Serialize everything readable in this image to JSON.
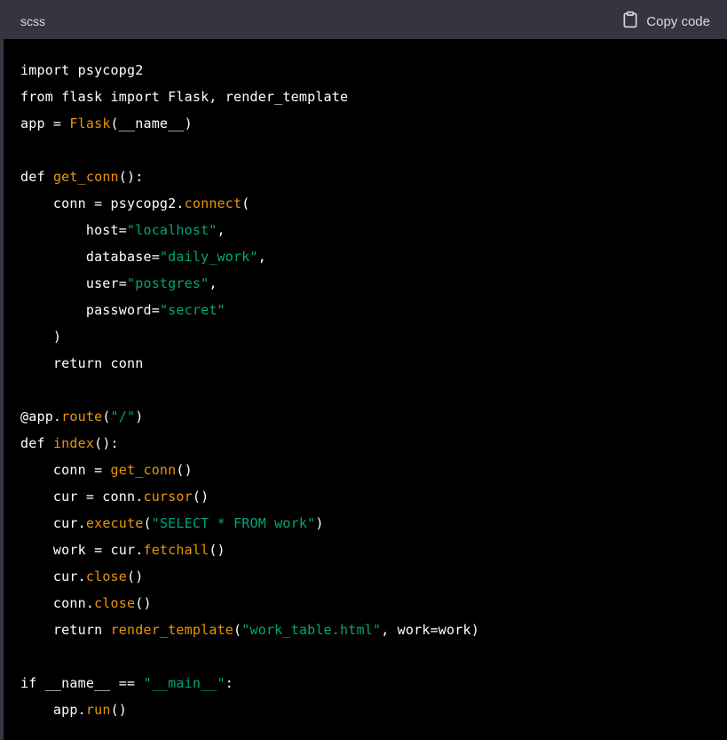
{
  "header": {
    "language": "scss",
    "copy_label": "Copy code",
    "copy_icon": "clipboard-icon"
  },
  "colors": {
    "function": "#e9950c",
    "string": "#00a67d",
    "plain": "#ffffff",
    "background": "#000000",
    "header_bg": "#343541"
  },
  "code_lines": [
    [
      {
        "t": "import psycopg2",
        "k": "plain"
      }
    ],
    [
      {
        "t": "from flask import Flask, render_template",
        "k": "plain"
      }
    ],
    [
      {
        "t": "app = ",
        "k": "plain"
      },
      {
        "t": "Flask",
        "k": "fn"
      },
      {
        "t": "(__name__)",
        "k": "plain"
      }
    ],
    [],
    [
      {
        "t": "def ",
        "k": "plain"
      },
      {
        "t": "get_conn",
        "k": "fn"
      },
      {
        "t": "():",
        "k": "plain"
      }
    ],
    [
      {
        "t": "    conn = psycopg2.",
        "k": "plain"
      },
      {
        "t": "connect",
        "k": "fn"
      },
      {
        "t": "(",
        "k": "plain"
      }
    ],
    [
      {
        "t": "        host=",
        "k": "plain"
      },
      {
        "t": "\"localhost\"",
        "k": "str"
      },
      {
        "t": ",",
        "k": "plain"
      }
    ],
    [
      {
        "t": "        database=",
        "k": "plain"
      },
      {
        "t": "\"daily_work\"",
        "k": "str"
      },
      {
        "t": ",",
        "k": "plain"
      }
    ],
    [
      {
        "t": "        user=",
        "k": "plain"
      },
      {
        "t": "\"postgres\"",
        "k": "str"
      },
      {
        "t": ",",
        "k": "plain"
      }
    ],
    [
      {
        "t": "        password=",
        "k": "plain"
      },
      {
        "t": "\"secret\"",
        "k": "str"
      }
    ],
    [
      {
        "t": "    )",
        "k": "plain"
      }
    ],
    [
      {
        "t": "    return conn",
        "k": "plain"
      }
    ],
    [],
    [
      {
        "t": "@app.",
        "k": "plain"
      },
      {
        "t": "route",
        "k": "fn"
      },
      {
        "t": "(",
        "k": "plain"
      },
      {
        "t": "\"/\"",
        "k": "str"
      },
      {
        "t": ")",
        "k": "plain"
      }
    ],
    [
      {
        "t": "def ",
        "k": "plain"
      },
      {
        "t": "index",
        "k": "fn"
      },
      {
        "t": "():",
        "k": "plain"
      }
    ],
    [
      {
        "t": "    conn = ",
        "k": "plain"
      },
      {
        "t": "get_conn",
        "k": "fn"
      },
      {
        "t": "()",
        "k": "plain"
      }
    ],
    [
      {
        "t": "    cur = conn.",
        "k": "plain"
      },
      {
        "t": "cursor",
        "k": "fn"
      },
      {
        "t": "()",
        "k": "plain"
      }
    ],
    [
      {
        "t": "    cur.",
        "k": "plain"
      },
      {
        "t": "execute",
        "k": "fn"
      },
      {
        "t": "(",
        "k": "plain"
      },
      {
        "t": "\"SELECT * FROM work\"",
        "k": "str"
      },
      {
        "t": ")",
        "k": "plain"
      }
    ],
    [
      {
        "t": "    work = cur.",
        "k": "plain"
      },
      {
        "t": "fetchall",
        "k": "fn"
      },
      {
        "t": "()",
        "k": "plain"
      }
    ],
    [
      {
        "t": "    cur.",
        "k": "plain"
      },
      {
        "t": "close",
        "k": "fn"
      },
      {
        "t": "()",
        "k": "plain"
      }
    ],
    [
      {
        "t": "    conn.",
        "k": "plain"
      },
      {
        "t": "close",
        "k": "fn"
      },
      {
        "t": "()",
        "k": "plain"
      }
    ],
    [
      {
        "t": "    return ",
        "k": "plain"
      },
      {
        "t": "render_template",
        "k": "fn"
      },
      {
        "t": "(",
        "k": "plain"
      },
      {
        "t": "\"work_table.html\"",
        "k": "str"
      },
      {
        "t": ", work=work)",
        "k": "plain"
      }
    ],
    [],
    [
      {
        "t": "if __name__ == ",
        "k": "plain"
      },
      {
        "t": "\"__main__\"",
        "k": "str"
      },
      {
        "t": ":",
        "k": "plain"
      }
    ],
    [
      {
        "t": "    app.",
        "k": "plain"
      },
      {
        "t": "run",
        "k": "fn"
      },
      {
        "t": "()",
        "k": "plain"
      }
    ]
  ]
}
